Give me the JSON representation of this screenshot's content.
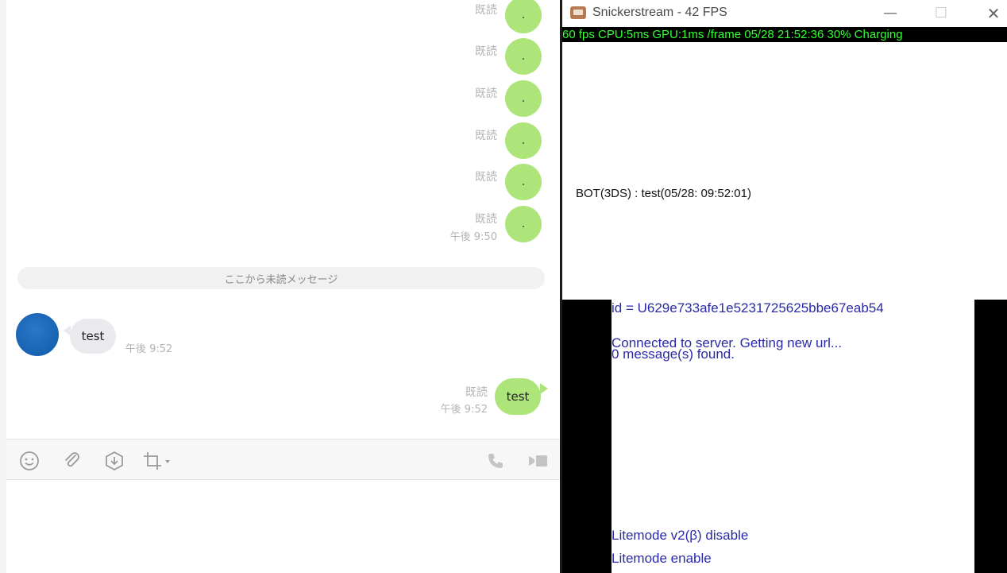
{
  "chat": {
    "read_label": "既読",
    "dot_messages": [
      ".",
      ".",
      ".",
      ".",
      ".",
      "."
    ],
    "dot_last_time": "午後 9:50",
    "unread_divider": "ここから未読メッセージ",
    "received": {
      "text": "test",
      "time": "午後 9:52"
    },
    "sent": {
      "text": "test",
      "read": "既読",
      "time": "午後 9:52"
    },
    "toolbar_icons": [
      "emoji-icon",
      "attachment-icon",
      "keep-icon",
      "screenshot-icon",
      "call-icon",
      "video-call-icon"
    ]
  },
  "stream": {
    "title": "Snickerstream - 42 FPS",
    "status": "60 fps CPU:5ms GPU:1ms /frame 05/28 21:52:36 30% Charging",
    "status_color": "#33ff33",
    "top_message": "BOT(3DS) : test(05/28: 09:52:01)",
    "bottom_lines": [
      "id = U629e733afe1e5231725625bbe67eab54",
      "Connected to server. Getting new url...",
      "0 message(s) found.",
      "Litemode v2(β) disable",
      "Litemode enable"
    ],
    "text_color": "#2a2aa8"
  }
}
